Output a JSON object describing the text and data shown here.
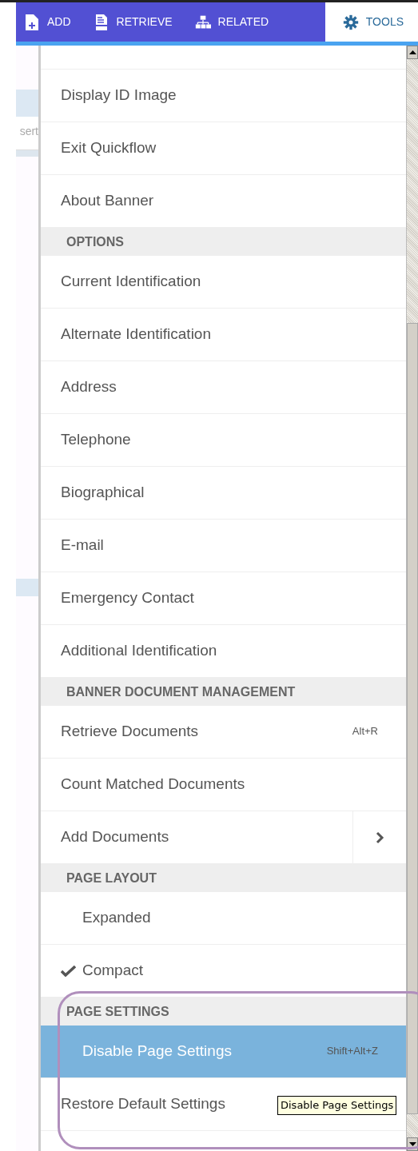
{
  "toolbar": {
    "tabs": [
      {
        "label": "ADD",
        "selected": false
      },
      {
        "label": "RETRIEVE",
        "selected": false
      },
      {
        "label": "RELATED",
        "selected": false
      },
      {
        "label": "TOOLS",
        "selected": true
      }
    ]
  },
  "background": {
    "text": "sert"
  },
  "menu": {
    "items": [
      {
        "kind": "item",
        "label": "Display ID Image",
        "selected": false
      },
      {
        "kind": "item",
        "label": "Exit Quickflow",
        "selected": false
      },
      {
        "kind": "item",
        "label": "About Banner",
        "selected": false
      },
      {
        "kind": "header",
        "label": "OPTIONS"
      },
      {
        "kind": "item",
        "label": "Current Identification",
        "selected": false
      },
      {
        "kind": "item",
        "label": "Alternate Identification",
        "selected": false
      },
      {
        "kind": "item",
        "label": "Address",
        "selected": false
      },
      {
        "kind": "item",
        "label": "Telephone",
        "selected": false
      },
      {
        "kind": "item",
        "label": "Biographical",
        "selected": false
      },
      {
        "kind": "item",
        "label": "E-mail",
        "selected": false
      },
      {
        "kind": "item",
        "label": "Emergency Contact",
        "selected": false
      },
      {
        "kind": "item",
        "label": "Additional Identification",
        "selected": false
      },
      {
        "kind": "header",
        "label": "BANNER DOCUMENT MANAGEMENT"
      },
      {
        "kind": "item",
        "label": "Retrieve Documents",
        "shortcut": "Alt+R",
        "selected": false
      },
      {
        "kind": "item",
        "label": "Count Matched Documents",
        "selected": false
      },
      {
        "kind": "submenu",
        "label": "Add Documents",
        "selected": false
      },
      {
        "kind": "header",
        "label": "PAGE LAYOUT"
      },
      {
        "kind": "toggle",
        "label": "Expanded",
        "checked": false,
        "selected": false
      },
      {
        "kind": "toggle",
        "label": "Compact",
        "checked": true,
        "selected": false
      },
      {
        "kind": "header",
        "label": "PAGE SETTINGS"
      },
      {
        "kind": "toggle",
        "label": "Disable Page Settings",
        "shortcut": "Shift+Alt+Z",
        "checked": false,
        "selected": true
      },
      {
        "kind": "item",
        "label": "Restore Default Settings",
        "selected": false
      }
    ]
  },
  "tooltip": {
    "text": "Disable Page Settings"
  }
}
